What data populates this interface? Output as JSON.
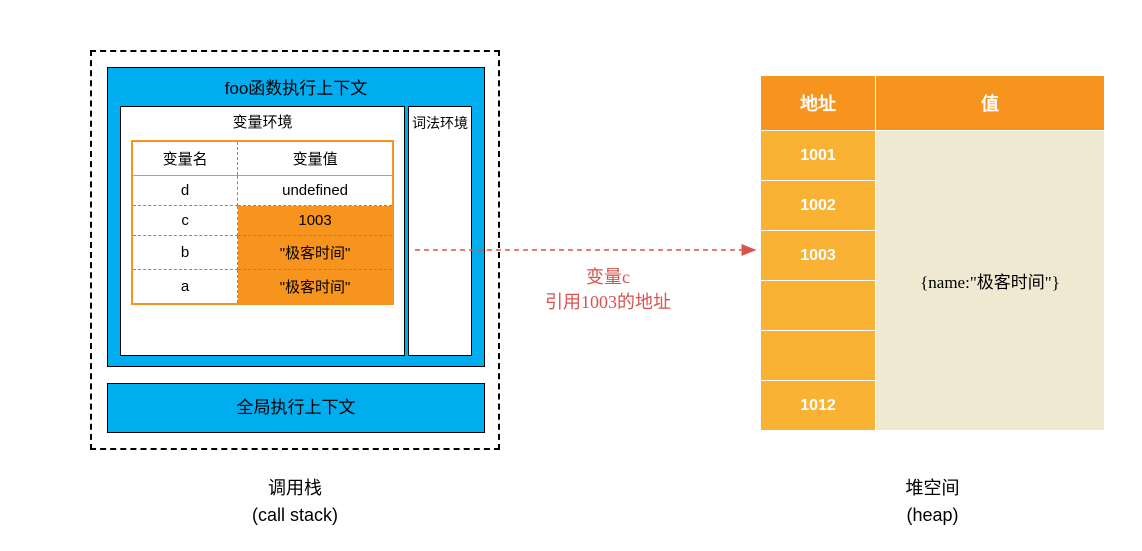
{
  "callstack": {
    "foo_title": "foo函数执行上下文",
    "var_env_title": "变量环境",
    "lex_env_title": "词法环境",
    "table": {
      "name_header": "变量名",
      "value_header": "变量值",
      "rows": [
        {
          "name": "d",
          "value": "undefined",
          "highlight": false
        },
        {
          "name": "c",
          "value": "1003",
          "highlight": true
        },
        {
          "name": "b",
          "value": "\"极客时间\"",
          "highlight": true
        },
        {
          "name": "a",
          "value": "\"极客时间\"",
          "highlight": true
        }
      ]
    },
    "global_title": "全局执行上下文",
    "caption_line1": "调用栈",
    "caption_line2": "(call stack)"
  },
  "heap": {
    "header_addr": "地址",
    "header_val": "值",
    "rows": [
      {
        "addr": "1001",
        "value": ""
      },
      {
        "addr": "1002",
        "value": ""
      },
      {
        "addr": "1003",
        "value": ""
      },
      {
        "addr": "",
        "value": "{name:\"极客时间\"}"
      },
      {
        "addr": "",
        "value": ""
      },
      {
        "addr": "1012",
        "value": ""
      }
    ],
    "caption_line1": "堆空间",
    "caption_line2": "(heap)"
  },
  "arrow": {
    "line1": "变量c",
    "line2": "引用1003的地址"
  },
  "chart_data": {
    "type": "table",
    "description": "Memory model diagram showing JavaScript call stack variable environment referencing heap address 1003",
    "stack_variables": [
      {
        "name": "d",
        "value": "undefined"
      },
      {
        "name": "c",
        "value": "1003 (heap ref)"
      },
      {
        "name": "b",
        "value": "\"极客时间\""
      },
      {
        "name": "a",
        "value": "\"极客时间\""
      }
    ],
    "heap_entries": [
      {
        "addr": "1001",
        "value": ""
      },
      {
        "addr": "1002",
        "value": ""
      },
      {
        "addr": "1003",
        "value": "{name:\"极客时间\"}"
      },
      {
        "addr": "1012",
        "value": ""
      }
    ],
    "reference_arrow": {
      "from": "stack variable c",
      "to": "heap address 1003",
      "label": "变量c 引用1003的地址"
    }
  }
}
